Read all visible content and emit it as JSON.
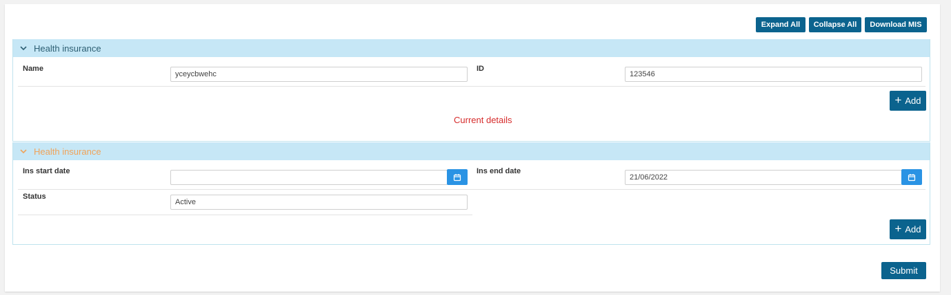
{
  "toolbar": {
    "expand_all": "Expand All",
    "collapse_all": "Collapse All",
    "download_mis": "Download MIS"
  },
  "sections": [
    {
      "title": "Health insurance",
      "fields": {
        "name_label": "Name",
        "name_value": "yceycbwehc",
        "id_label": "ID",
        "id_value": "123546"
      },
      "add_label": "Add",
      "message": "Current details"
    },
    {
      "title": "Health insurance",
      "fields": {
        "start_label": "Ins start date",
        "start_value": "",
        "end_label": "Ins end date",
        "end_value": "21/06/2022",
        "status_label": "Status",
        "status_value": "Active"
      },
      "add_label": "Add"
    }
  ],
  "submit_label": "Submit",
  "colors": {
    "primary_button": "#0b638e",
    "section_header": "#c6e7f6",
    "calendar_button": "#2a93e4",
    "message_text": "#d62b2b",
    "muted_title": "#f0a35a"
  },
  "icons": {
    "add": "plus-icon",
    "expand": "chevron-down-icon",
    "date": "calendar-icon"
  }
}
